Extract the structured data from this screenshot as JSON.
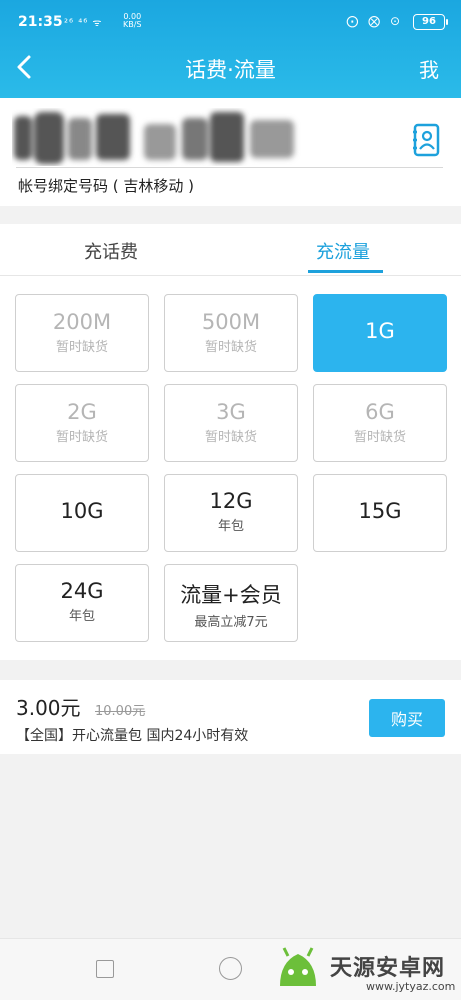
{
  "status_bar": {
    "time": "21:35",
    "left_icons": "²⁶ ⁴⁶ ᯤ",
    "speed_value": "0.00",
    "speed_unit": "KB/S",
    "right_icons": "⨀ ⨂ ⊙",
    "battery": "96"
  },
  "header": {
    "title": "话费·流量",
    "me": "我",
    "color": "#1ba7e0"
  },
  "account": {
    "label": "帐号绑定号码 ( 吉林移动 )"
  },
  "tabs": [
    {
      "label": "充话费",
      "active": false
    },
    {
      "label": "充流量",
      "active": true
    }
  ],
  "packages": [
    {
      "main": "200M",
      "sub": "暂时缺货",
      "state": "disabled"
    },
    {
      "main": "500M",
      "sub": "暂时缺货",
      "state": "disabled"
    },
    {
      "main": "1G",
      "sub": "",
      "state": "selected"
    },
    {
      "main": "2G",
      "sub": "暂时缺货",
      "state": "disabled"
    },
    {
      "main": "3G",
      "sub": "暂时缺货",
      "state": "disabled"
    },
    {
      "main": "6G",
      "sub": "暂时缺货",
      "state": "disabled"
    },
    {
      "main": "10G",
      "sub": "",
      "state": "normal"
    },
    {
      "main": "12G",
      "sub": "年包",
      "state": "normal"
    },
    {
      "main": "15G",
      "sub": "",
      "state": "normal"
    },
    {
      "main": "24G",
      "sub": "年包",
      "state": "normal"
    },
    {
      "main": "流量+会员",
      "sub": "最高立减7元",
      "state": "normal"
    }
  ],
  "price": {
    "current": "3.00元",
    "original": "10.00元",
    "description": "【全国】开心流量包 国内24小时有效",
    "buy_label": "购买",
    "accent": "#2cb4ee"
  },
  "watermark": {
    "text": "天源安卓网",
    "url": "www.jytyaz.com"
  }
}
